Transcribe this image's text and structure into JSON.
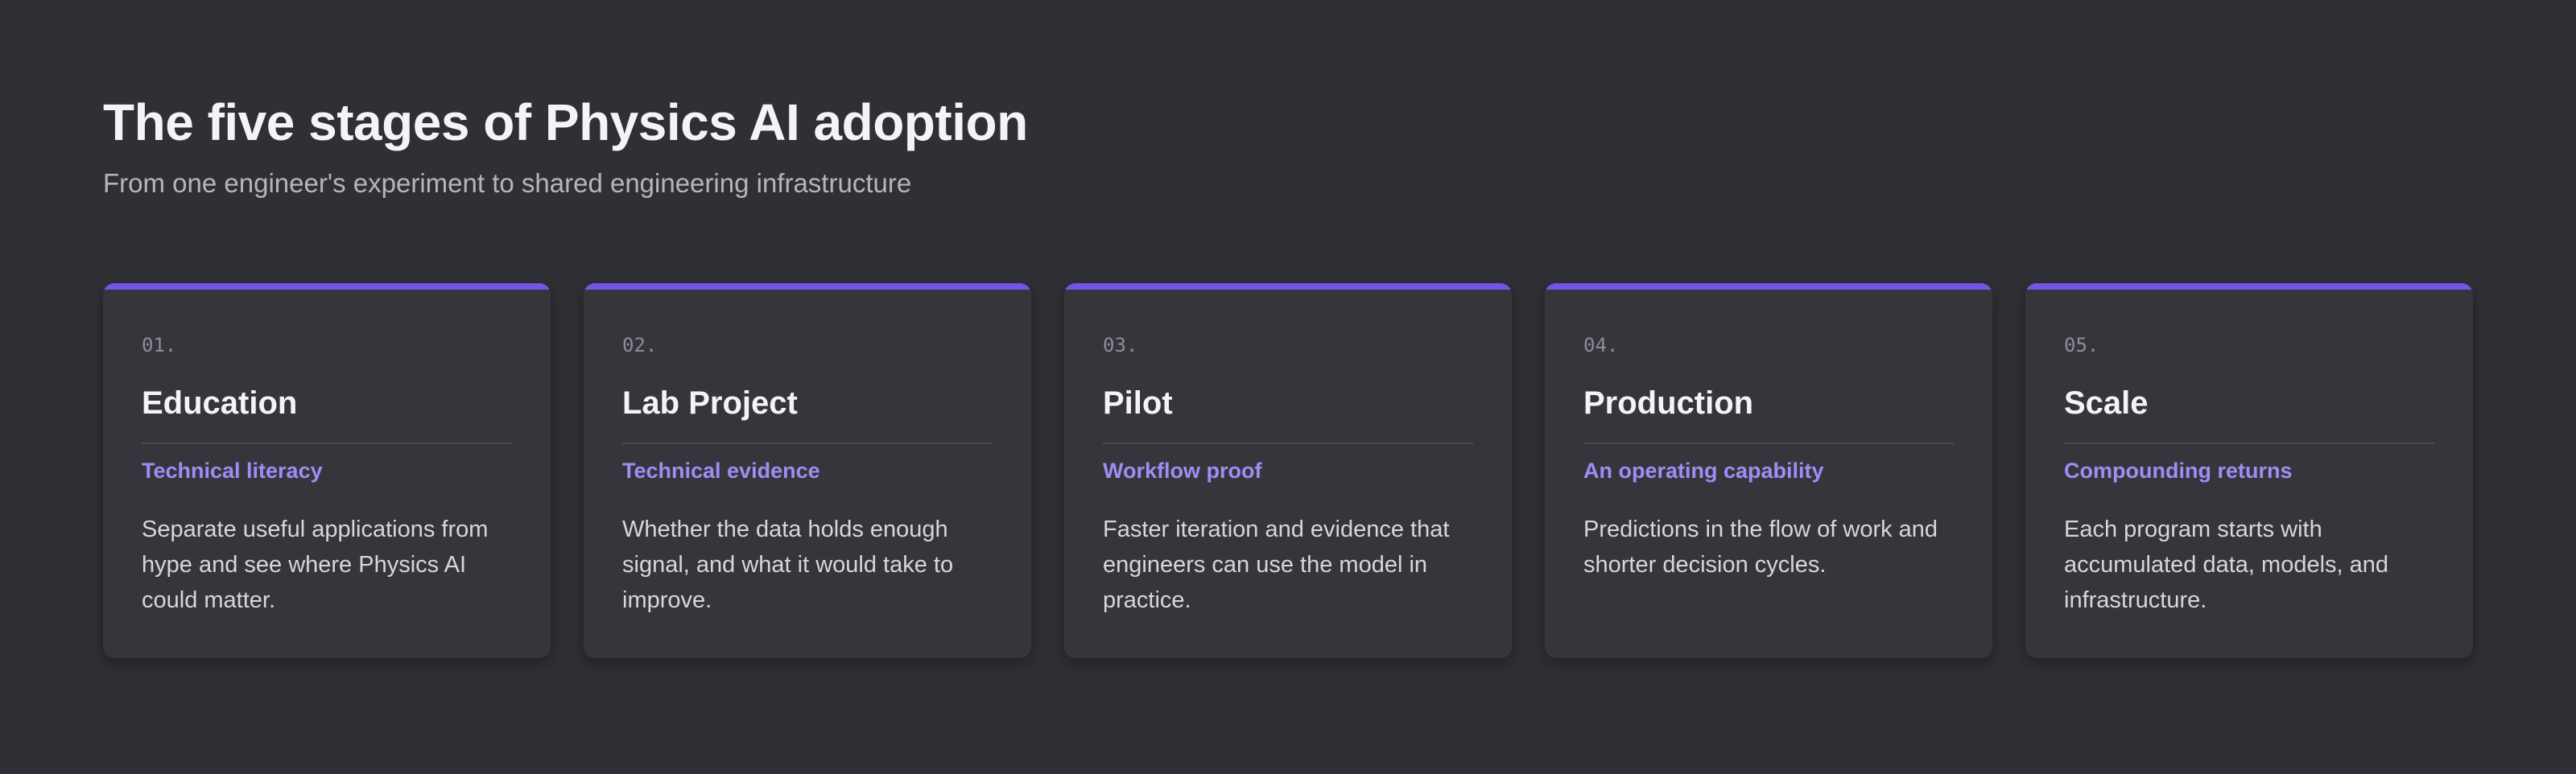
{
  "header": {
    "title": "The five stages of Physics AI adoption",
    "subtitle": "From one engineer's experiment to shared engineering infrastructure"
  },
  "colors": {
    "background": "#2f3035",
    "card_background": "#35363c",
    "accent": "#7456e6",
    "tagline": "#a08cf5"
  },
  "stages": [
    {
      "number": "01.",
      "title": "Education",
      "tagline": "Technical literacy",
      "body": "Separate useful applications from hype and see where Physics AI could matter."
    },
    {
      "number": "02.",
      "title": "Lab Project",
      "tagline": "Technical evidence",
      "body": "Whether the data holds enough signal, and what it would take to improve."
    },
    {
      "number": "03.",
      "title": "Pilot",
      "tagline": "Workflow proof",
      "body": "Faster iteration and evidence that engineers can use the model in practice."
    },
    {
      "number": "04.",
      "title": "Production",
      "tagline": "An operating capability",
      "body": "Predictions in the flow of work and shorter decision cycles."
    },
    {
      "number": "05.",
      "title": "Scale",
      "tagline": "Compounding returns",
      "body": "Each program starts with accumulated data, models, and infrastructure."
    }
  ]
}
